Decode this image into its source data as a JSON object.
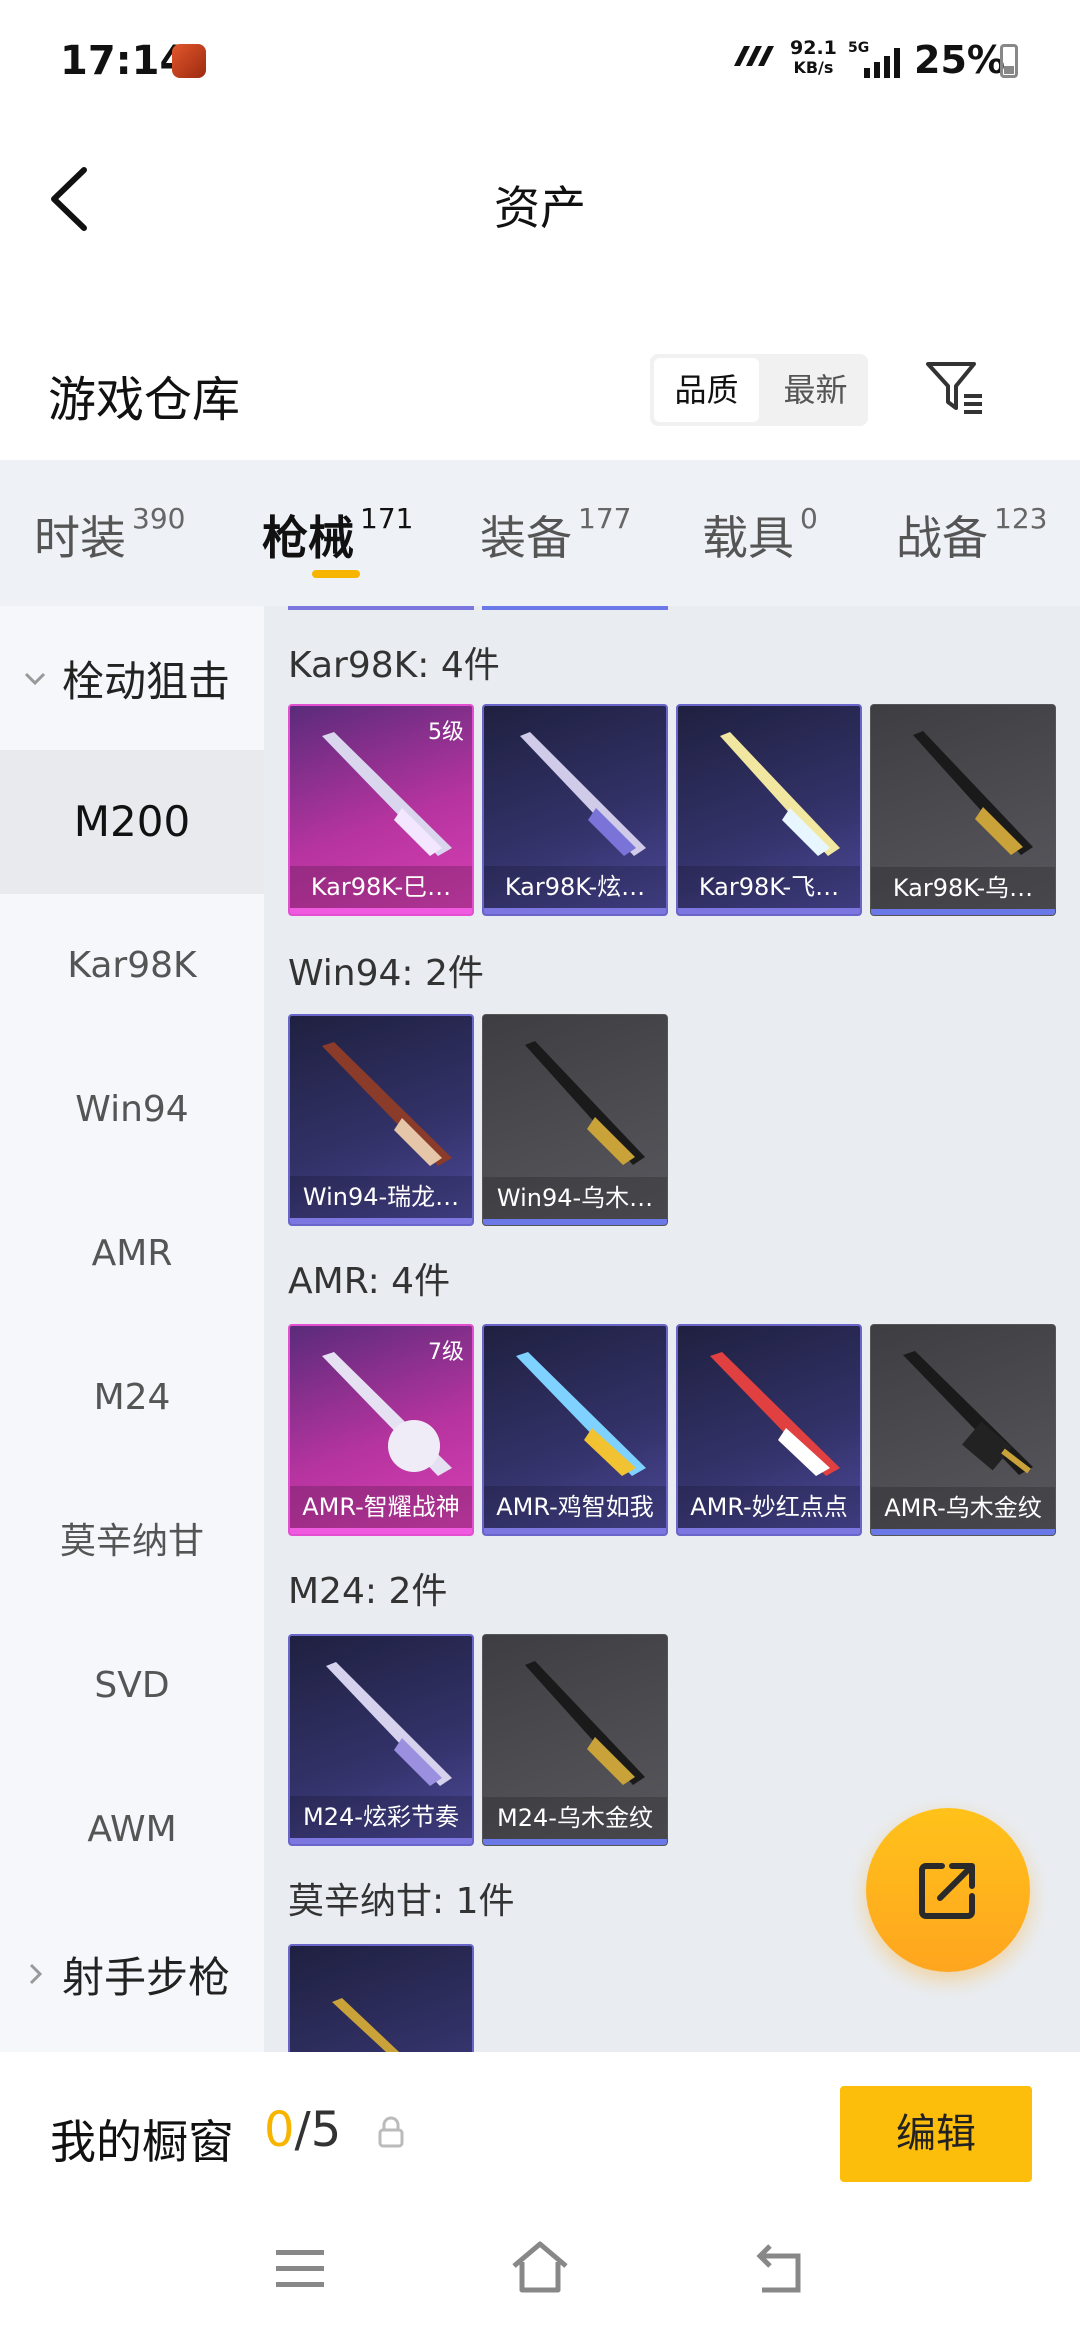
{
  "status": {
    "time": "17:14",
    "speed_top": "92.1",
    "speed_unit": "KB/s",
    "network": "5G",
    "battery": "25%"
  },
  "header": {
    "title": "资产"
  },
  "warehouse": {
    "label": "游戏仓库",
    "sort_options": [
      "品质",
      "最新"
    ],
    "active_sort": "品质"
  },
  "tabs": [
    {
      "label": "时装",
      "count": "390"
    },
    {
      "label": "枪械",
      "count": "171",
      "active": true
    },
    {
      "label": "装备",
      "count": "177"
    },
    {
      "label": "载具",
      "count": "0"
    },
    {
      "label": "战备",
      "count": "123"
    }
  ],
  "sidebar": {
    "group1": "栓动狙击",
    "items": [
      "M200",
      "Kar98K",
      "Win94",
      "AMR",
      "M24",
      "莫辛纳甘",
      "SVD",
      "AWM"
    ],
    "active_item": "M200",
    "group2": "射手步枪"
  },
  "sections": [
    {
      "title": "Kar98K: 4件",
      "cards": [
        {
          "name": "Kar98K-巳…",
          "rarity": "pink",
          "level": "5级"
        },
        {
          "name": "Kar98K-炫…",
          "rarity": "purple"
        },
        {
          "name": "Kar98K-飞…",
          "rarity": "purple"
        },
        {
          "name": "Kar98K-乌…",
          "rarity": "gray"
        }
      ]
    },
    {
      "title": "Win94: 2件",
      "cards": [
        {
          "name": "Win94-瑞龙…",
          "rarity": "purple"
        },
        {
          "name": "Win94-乌木…",
          "rarity": "gray"
        }
      ]
    },
    {
      "title": "AMR: 4件",
      "cards": [
        {
          "name": "AMR-智耀战神",
          "rarity": "pink",
          "level": "7级"
        },
        {
          "name": "AMR-鸡智如我",
          "rarity": "purple"
        },
        {
          "name": "AMR-妙红点点",
          "rarity": "purple"
        },
        {
          "name": "AMR-乌木金纹",
          "rarity": "gray"
        }
      ]
    },
    {
      "title": "M24: 2件",
      "cards": [
        {
          "name": "M24-炫彩节奏",
          "rarity": "purple"
        },
        {
          "name": "M24-乌木金纹",
          "rarity": "gray"
        }
      ]
    },
    {
      "title": "莫辛纳甘: 1件",
      "cards": [
        {
          "name": "",
          "rarity": "purple"
        }
      ]
    }
  ],
  "showcase": {
    "label": "我的橱窗",
    "current": "0",
    "total": "/5",
    "edit_label": "编辑"
  },
  "colors": {
    "accent": "#f7b500",
    "pink": "#d83fb4",
    "purple": "#4e4a9c",
    "gray": "#58585e"
  }
}
